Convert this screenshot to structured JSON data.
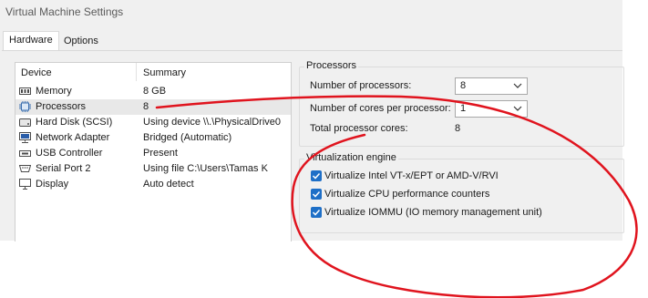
{
  "window": {
    "title": "Virtual Machine Settings"
  },
  "tabs": [
    {
      "label": "Hardware",
      "selected": true
    },
    {
      "label": "Options",
      "selected": false
    }
  ],
  "device_list": {
    "columns": [
      "Device",
      "Summary"
    ],
    "rows": [
      {
        "icon": "memory-icon",
        "device": "Memory",
        "summary": "8 GB"
      },
      {
        "icon": "processor-icon",
        "device": "Processors",
        "summary": "8",
        "selected": true
      },
      {
        "icon": "hard-disk-icon",
        "device": "Hard Disk (SCSI)",
        "summary": "Using device \\\\.\\PhysicalDrive0"
      },
      {
        "icon": "network-adapter-icon",
        "device": "Network Adapter",
        "summary": "Bridged (Automatic)"
      },
      {
        "icon": "usb-controller-icon",
        "device": "USB Controller",
        "summary": "Present"
      },
      {
        "icon": "serial-port-icon",
        "device": "Serial Port 2",
        "summary": "Using file C:\\Users\\Tamas K"
      },
      {
        "icon": "display-icon",
        "device": "Display",
        "summary": "Auto detect"
      }
    ]
  },
  "processors": {
    "group_label": "Processors",
    "num_processors_label": "Number of processors:",
    "num_processors_value": "8",
    "cores_label": "Number of cores per processor:",
    "cores_value": "1",
    "total_label": "Total processor cores:",
    "total_value": "8"
  },
  "virtualization": {
    "group_label": "Virtualization engine",
    "options": [
      {
        "label": "Virtualize Intel VT-x/EPT or AMD-V/RVI",
        "checked": true
      },
      {
        "label": "Virtualize CPU performance counters",
        "checked": true
      },
      {
        "label": "Virtualize IOMMU (IO memory management unit)",
        "checked": true
      }
    ]
  },
  "colors": {
    "annotation": "#e0141e",
    "checkbox": "#1e6fc7",
    "selection": "#e8e8e8"
  }
}
